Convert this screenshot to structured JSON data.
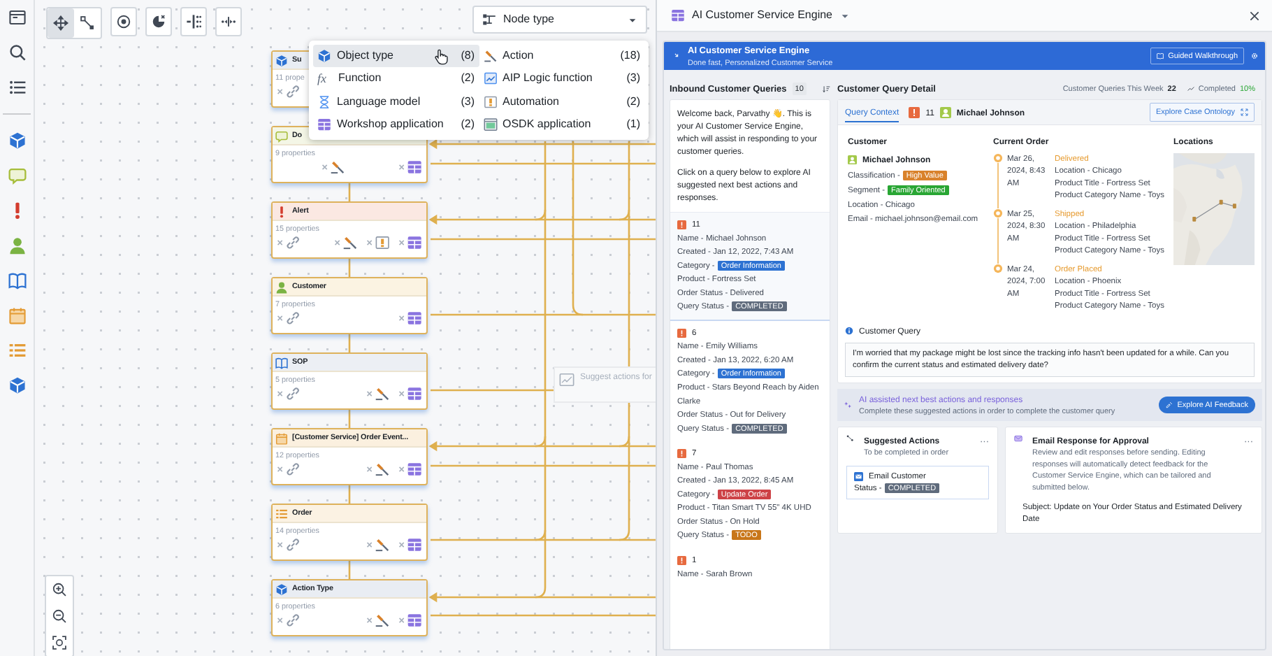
{
  "tool_group": [
    {
      "kind": "pan",
      "selected": true
    },
    {
      "kind": "connect",
      "selected": false
    }
  ],
  "tools": [
    {
      "kind": "focus"
    },
    {
      "kind": "pie"
    },
    {
      "kind": "layout"
    },
    {
      "kind": "collapse"
    }
  ],
  "node_type_select": {
    "value": "Node type"
  },
  "node_type_menu": [
    {
      "kind": "object",
      "label": "Object type",
      "count": "(8)",
      "highlighted": true
    },
    {
      "kind": "action",
      "label": "Action",
      "count": "(18)",
      "highlighted": false
    },
    {
      "kind": "function",
      "glyph": "fx",
      "label": "Function",
      "count": "(2)",
      "highlighted": false
    },
    {
      "kind": "aip",
      "label": "AIP Logic function",
      "count": "(3)",
      "highlighted": false
    },
    {
      "kind": "model",
      "label": "Language model",
      "count": "(3)",
      "highlighted": false
    },
    {
      "kind": "automation",
      "label": "Automation",
      "count": "(2)",
      "highlighted": false
    },
    {
      "kind": "workshop",
      "label": "Workshop application",
      "count": "(2)",
      "highlighted": false
    },
    {
      "kind": "osdk",
      "label": "OSDK application",
      "count": "(1)",
      "highlighted": false
    }
  ],
  "nodes": [
    {
      "kind": "object",
      "title": "Su",
      "properties": "11 prope",
      "footer": [
        {
          "kind": "link"
        }
      ]
    },
    {
      "kind": "speech",
      "title": "Do",
      "properties": "9 properties",
      "footer": [
        {
          "kind": "action"
        },
        {
          "kind": "workshop"
        }
      ]
    },
    {
      "kind": "alert",
      "title": "Alert",
      "properties": "15 properties",
      "footer": [
        {
          "kind": "link"
        },
        {
          "kind": "action"
        },
        {
          "kind": "automation"
        },
        {
          "kind": "workshop"
        }
      ]
    },
    {
      "kind": "person",
      "title": "Customer",
      "properties": "7 properties",
      "footer": [
        {
          "kind": "link"
        },
        {
          "kind": "workshop"
        }
      ]
    },
    {
      "kind": "book",
      "title": "SOP",
      "properties": "5 properties",
      "footer": [
        {
          "kind": "link"
        },
        {
          "kind": "action"
        },
        {
          "kind": "workshop"
        }
      ]
    },
    {
      "kind": "calendar",
      "title": "[Customer Service] Order Event...",
      "properties": "12 properties",
      "footer": [
        {
          "kind": "link"
        },
        {
          "kind": "action"
        },
        {
          "kind": "workshop"
        }
      ]
    },
    {
      "kind": "list",
      "title": "Order",
      "properties": "14 properties",
      "footer": [
        {
          "kind": "link"
        },
        {
          "kind": "action"
        },
        {
          "kind": "workshop"
        }
      ]
    },
    {
      "kind": "object",
      "title": "Action Type",
      "properties": "6 properties",
      "footer": [
        {
          "kind": "link"
        },
        {
          "kind": "action"
        },
        {
          "kind": "workshop"
        }
      ]
    }
  ],
  "ghost_node": {
    "title": "Suggest actions for"
  },
  "panel": {
    "title": "AI Customer Service Engine"
  },
  "preview": {
    "app_title": "AI Customer Service Engine",
    "app_subtitle": "Done fast, Personalized Customer Service",
    "walkthrough": "Guided Walkthrough",
    "queries_title": "Inbound Customer Queries",
    "queries_count": "10",
    "welcome": [
      "Welcome back, Parvathy 👋. This is your AI Customer Service Engine, which will assist in responding to your customer queries.",
      "Click on a query below to explore AI suggested next best actions and responses."
    ],
    "queries": [
      {
        "number": "11",
        "selected": true,
        "fields": [
          {
            "text": "Name - Michael Johnson"
          },
          {
            "text": "Created - Jan 12, 2022, 7:43 AM"
          },
          {
            "text": "Category -",
            "tag": "Order Information",
            "color": "#2d72d2"
          },
          {
            "text": "Product - Fortress Set"
          },
          {
            "text": "Order Status - Delivered"
          },
          {
            "text": "Query Status -",
            "tag": "COMPLETED",
            "color": "#5f6b7c"
          }
        ]
      },
      {
        "number": "6",
        "selected": false,
        "fields": [
          {
            "text": "Name - Emily Williams"
          },
          {
            "text": "Created - Jan 13, 2022, 6:20 AM"
          },
          {
            "text": "Category -",
            "tag": "Order Information",
            "color": "#2d72d2"
          },
          {
            "text": "Product - Stars Beyond Reach by Aiden Clarke"
          },
          {
            "text": "Order Status - Out for Delivery"
          },
          {
            "text": "Query Status -",
            "tag": "COMPLETED",
            "color": "#5f6b7c"
          }
        ]
      },
      {
        "number": "7",
        "selected": false,
        "fields": [
          {
            "text": "Name - Paul Thomas"
          },
          {
            "text": "Created - Jan 13, 2022, 8:45 AM"
          },
          {
            "text": "Category -",
            "tag": "Update Order",
            "color": "#cd4246"
          },
          {
            "text": "Product - Titan Smart TV 55\" 4K UHD"
          },
          {
            "text": "Order Status - On Hold"
          },
          {
            "text": "Query Status -",
            "tag": "TODO",
            "color": "#c87619"
          }
        ]
      },
      {
        "number": "1",
        "selected": false,
        "fields": [
          {
            "text": "Name - Sarah Brown"
          }
        ]
      }
    ],
    "detail_title": "Customer Query Detail",
    "stats": [
      {
        "label": "Customer Queries This Week",
        "value": "22"
      },
      {
        "label": "Completed",
        "value": "10%"
      }
    ],
    "context_tab": "Query Context",
    "query_number": "11",
    "customer_name": "Michael Johnson",
    "ontology_button": "Explore Case Ontology",
    "customer": {
      "heading": "Customer",
      "name": "Michael Johnson",
      "fields": [
        {
          "text": "Classification -",
          "tag": "High Value",
          "color": "#d9822b"
        },
        {
          "text": "Segment -",
          "tag": "Family Oriented",
          "color": "#29a634"
        },
        {
          "text": "Location - Chicago"
        },
        {
          "text": "Email - michael.johnson@email.com"
        }
      ]
    },
    "order": {
      "heading": "Current Order",
      "events": [
        {
          "date": "Mar 26, 2024, 8:43 AM",
          "status": "Delivered",
          "fields": [
            "Location - Chicago",
            "Product Title - Fortress Set",
            "Product Category Name - Toys"
          ]
        },
        {
          "date": "Mar 25, 2024, 8:30 AM",
          "status": "Shipped",
          "fields": [
            "Location - Philadelphia",
            "Product Title - Fortress Set",
            "Product Category Name - Toys"
          ]
        },
        {
          "date": "Mar 24, 2024, 7:00 AM",
          "status": "Order Placed",
          "fields": [
            "Location - Phoenix",
            "Product Title - Fortress Set",
            "Product Category Name - Toys"
          ]
        }
      ]
    },
    "locations": {
      "heading": "Locations"
    },
    "query": {
      "heading": "Customer Query",
      "text": "I'm worried that my package might be lost since the tracking info hasn't been updated for a while. Can you confirm the current status and estimated delivery date?"
    },
    "ai": {
      "title": "AI assisted next best actions and responses",
      "subtitle": "Complete these suggested actions in order to complete the customer query",
      "button": "Explore AI Feedback"
    },
    "actions": {
      "title": "Suggested Actions",
      "subtitle": "To be completed in order",
      "more": "···",
      "items": [
        {
          "title": "Email Customer",
          "label": "Status -",
          "status": "COMPLETED"
        }
      ]
    },
    "email": {
      "title": "Email Response for Approval",
      "subtitle": "Review and edit responses before sending. Editing responses will automatically detect feedback for the Customer Service Engine, which can be tailored and submitted below.",
      "more": "···",
      "subject": "Subject: Update on Your Order Status and Estimated Delivery Date"
    }
  }
}
